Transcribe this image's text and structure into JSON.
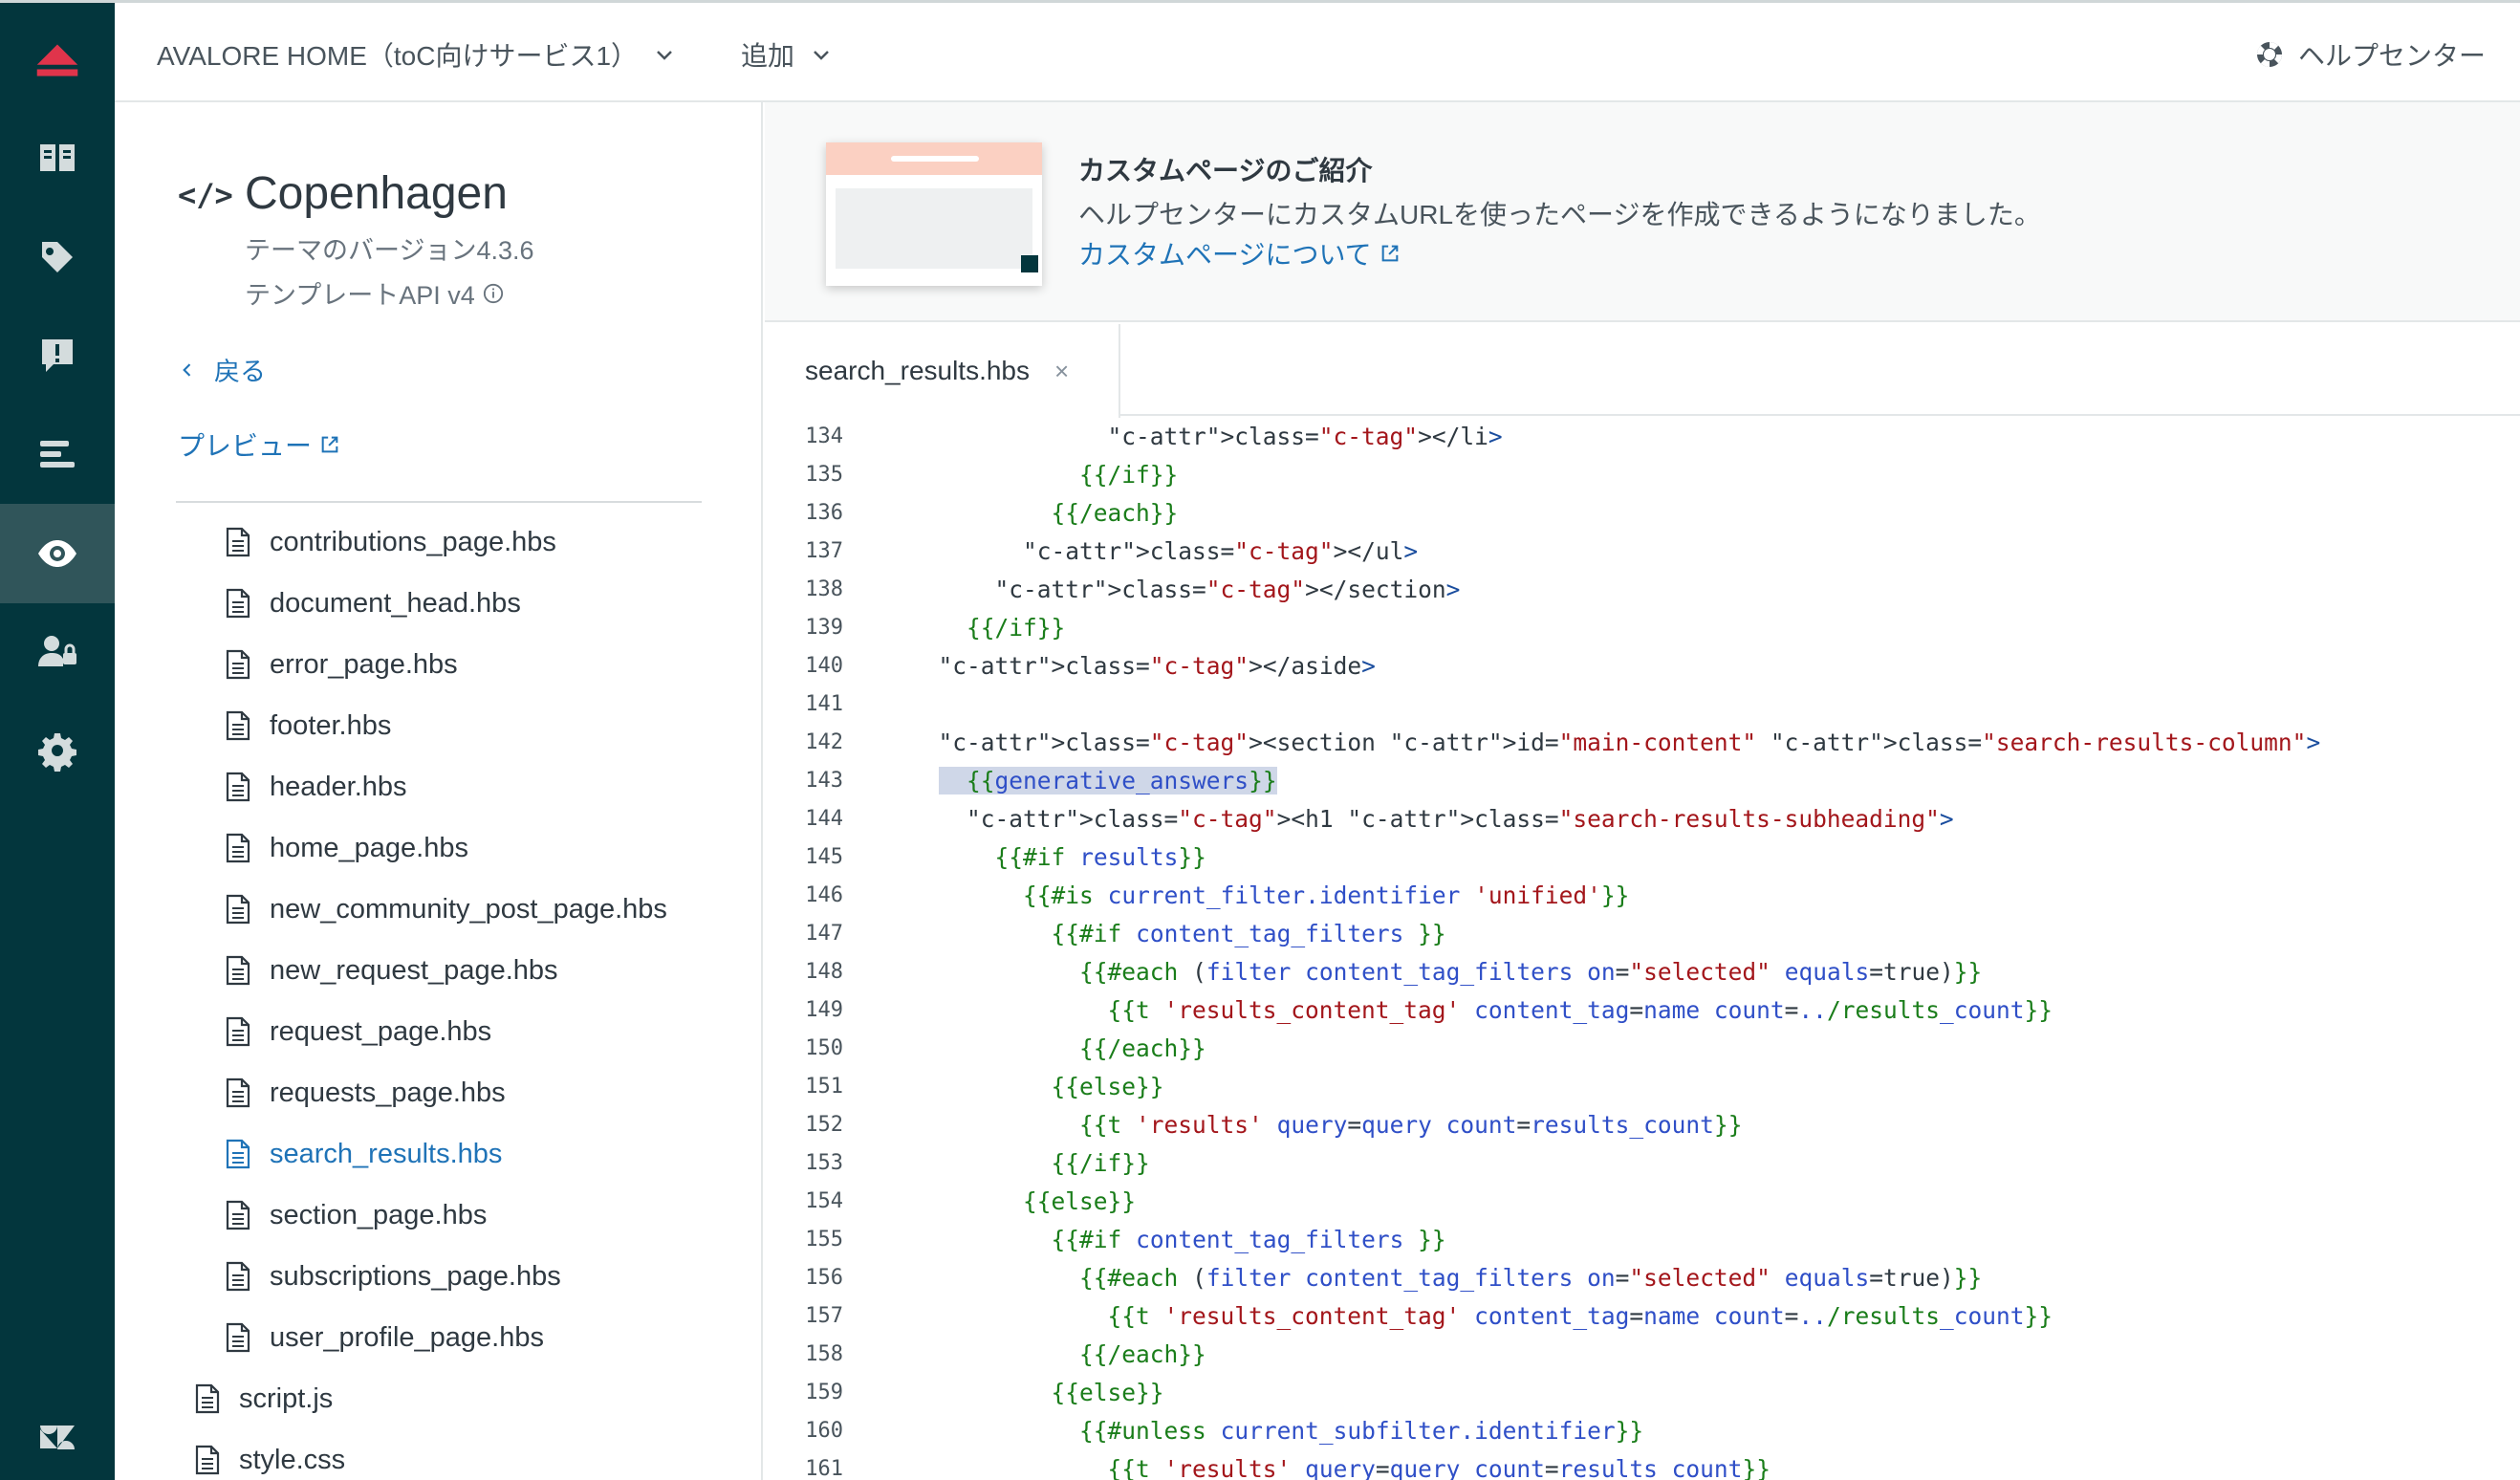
{
  "topbar": {
    "brand_dropdown": "AVALORE HOME（toC向けサービス1）",
    "add_dropdown": "追加",
    "help_center": "ヘルプセンター"
  },
  "rail": {
    "items": [
      "logo-icon",
      "guide-icon",
      "tag-icon",
      "feedback-icon",
      "list-icon",
      "eye-icon",
      "user-lock-icon",
      "gear-icon",
      "zendesk-logo-icon"
    ],
    "active": "eye-icon"
  },
  "theme": {
    "name": "Copenhagen",
    "version": "テーマのバージョン4.3.6",
    "template_api": "テンプレートAPI v4",
    "back": "戻る",
    "preview": "プレビュー"
  },
  "files": {
    "nested": [
      "contributions_page.hbs",
      "document_head.hbs",
      "error_page.hbs",
      "footer.hbs",
      "header.hbs",
      "home_page.hbs",
      "new_community_post_page.hbs",
      "new_request_page.hbs",
      "request_page.hbs",
      "requests_page.hbs",
      "search_results.hbs",
      "section_page.hbs",
      "subscriptions_page.hbs",
      "user_profile_page.hbs"
    ],
    "root": [
      "script.js",
      "style.css"
    ],
    "active": "search_results.hbs"
  },
  "banner": {
    "title": "カスタムページのご紹介",
    "text": "ヘルプセンターにカスタムURLを使ったページを作成できるようになりました。",
    "link": "カスタムページについて"
  },
  "editor": {
    "tab": "search_results.hbs",
    "tab_close": "×",
    "highlighted_line": 143,
    "lines": [
      {
        "n": "134",
        "t": "              </li>"
      },
      {
        "n": "135",
        "t": "            {{/if}}"
      },
      {
        "n": "136",
        "t": "          {{/each}}"
      },
      {
        "n": "137",
        "t": "        </ul>"
      },
      {
        "n": "138",
        "t": "      </section>"
      },
      {
        "n": "139",
        "t": "    {{/if}}"
      },
      {
        "n": "140",
        "t": "  </aside>"
      },
      {
        "n": "141",
        "t": ""
      },
      {
        "n": "142",
        "t": "  <section id=\"main-content\" class=\"search-results-column\">"
      },
      {
        "n": "143",
        "t": "    {{generative_answers}}"
      },
      {
        "n": "144",
        "t": "    <h1 class=\"search-results-subheading\">"
      },
      {
        "n": "145",
        "t": "      {{#if results}}"
      },
      {
        "n": "146",
        "t": "        {{#is current_filter.identifier 'unified'}}"
      },
      {
        "n": "147",
        "t": "          {{#if content_tag_filters }}"
      },
      {
        "n": "148",
        "t": "            {{#each (filter content_tag_filters on=\"selected\" equals=true)}}"
      },
      {
        "n": "149",
        "t": "              {{t 'results_content_tag' content_tag=name count=../results_count}}"
      },
      {
        "n": "150",
        "t": "            {{/each}}"
      },
      {
        "n": "151",
        "t": "          {{else}}"
      },
      {
        "n": "152",
        "t": "            {{t 'results' query=query count=results_count}}"
      },
      {
        "n": "153",
        "t": "          {{/if}}"
      },
      {
        "n": "154",
        "t": "        {{else}}"
      },
      {
        "n": "155",
        "t": "          {{#if content_tag_filters }}"
      },
      {
        "n": "156",
        "t": "            {{#each (filter content_tag_filters on=\"selected\" equals=true)}}"
      },
      {
        "n": "157",
        "t": "              {{t 'results_content_tag' content_tag=name count=../results_count}}"
      },
      {
        "n": "158",
        "t": "            {{/each}}"
      },
      {
        "n": "159",
        "t": "          {{else}}"
      },
      {
        "n": "160",
        "t": "            {{#unless current_subfilter.identifier}}"
      },
      {
        "n": "161",
        "t": "              {{t 'results' query=query count=results_count}}"
      }
    ]
  },
  "colors": {
    "rail_bg": "#03363d",
    "rail_active": "#30555a",
    "accent_red": "#e0344b",
    "link_blue": "#1f73b7"
  }
}
